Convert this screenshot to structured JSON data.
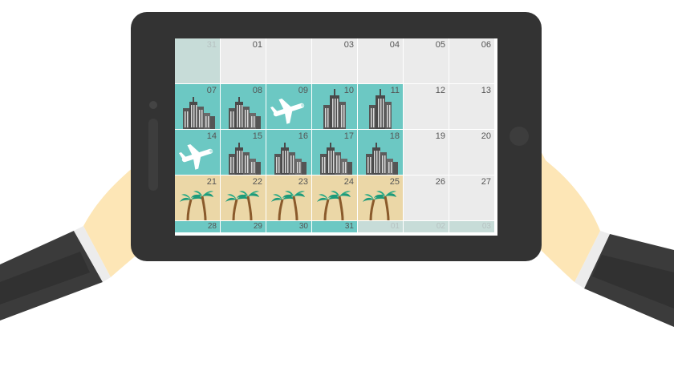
{
  "colors": {
    "tablet_body": "#333333",
    "empty_day": "#ebebeb",
    "out_of_month_day": "#c7dcd8",
    "city_day": "#6cc8c3",
    "beach_day": "#ebd7a7",
    "sleeve": "#3b3b3b",
    "skin": "#fde6b6",
    "cuff": "#ececec"
  },
  "calendar": {
    "weeks": [
      [
        {
          "day": "31",
          "theme": "muted"
        },
        {
          "day": "01",
          "theme": "empty"
        },
        {
          "day": "",
          "theme": "empty"
        },
        {
          "day": "03",
          "theme": "empty"
        },
        {
          "day": "04",
          "theme": "empty"
        },
        {
          "day": "05",
          "theme": "empty"
        },
        {
          "day": "06",
          "theme": "empty"
        }
      ],
      [
        {
          "day": "07",
          "theme": "city",
          "icon": "city-skyline-icon"
        },
        {
          "day": "08",
          "theme": "city",
          "icon": "city-skyline-icon"
        },
        {
          "day": "09",
          "theme": "city",
          "icon": "airplane-icon"
        },
        {
          "day": "10",
          "theme": "city",
          "icon": "skyscraper-icon"
        },
        {
          "day": "11",
          "theme": "city",
          "icon": "skyscraper-icon"
        },
        {
          "day": "12",
          "theme": "empty"
        },
        {
          "day": "13",
          "theme": "empty"
        }
      ],
      [
        {
          "day": "14",
          "theme": "city",
          "icon": "airplane-icon"
        },
        {
          "day": "15",
          "theme": "city",
          "icon": "city-skyline-icon"
        },
        {
          "day": "16",
          "theme": "city",
          "icon": "city-skyline-icon"
        },
        {
          "day": "17",
          "theme": "city",
          "icon": "city-skyline-icon"
        },
        {
          "day": "18",
          "theme": "city",
          "icon": "city-skyline-icon"
        },
        {
          "day": "19",
          "theme": "empty"
        },
        {
          "day": "20",
          "theme": "empty"
        }
      ],
      [
        {
          "day": "21",
          "theme": "beach",
          "icon": "palm-trees-icon"
        },
        {
          "day": "22",
          "theme": "beach",
          "icon": "palm-trees-icon"
        },
        {
          "day": "23",
          "theme": "beach",
          "icon": "palm-trees-icon"
        },
        {
          "day": "24",
          "theme": "beach",
          "icon": "palm-trees-icon"
        },
        {
          "day": "25",
          "theme": "beach",
          "icon": "palm-trees-icon"
        },
        {
          "day": "26",
          "theme": "empty"
        },
        {
          "day": "27",
          "theme": "empty"
        }
      ],
      [
        {
          "day": "28",
          "theme": "city"
        },
        {
          "day": "29",
          "theme": "city"
        },
        {
          "day": "30",
          "theme": "city"
        },
        {
          "day": "31",
          "theme": "city"
        },
        {
          "day": "01",
          "theme": "muted"
        },
        {
          "day": "02",
          "theme": "muted"
        },
        {
          "day": "03",
          "theme": "muted"
        }
      ]
    ]
  }
}
